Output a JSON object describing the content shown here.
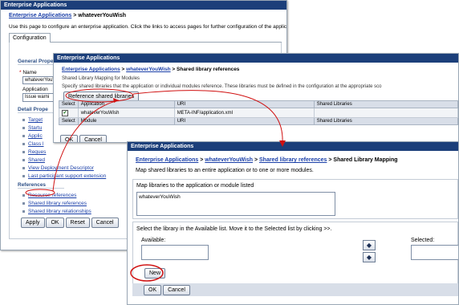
{
  "panel1": {
    "title": "Enterprise Applications",
    "breadcrumb_link": "Enterprise Applications",
    "breadcrumb_sep": " > ",
    "breadcrumb_current": "whateverYouWish",
    "description": "Use this page to configure an enterprise application. Click the links to access pages for further configuration of the applica",
    "tab": "Configuration",
    "general_heading": "General Prope",
    "name_label": "Name",
    "name_value": "whateverYouW",
    "application_label": "Application",
    "issue_value": "Issue warni",
    "detail_heading": "Detail Prope",
    "detail_links": [
      "Target",
      "Startu",
      "Applic",
      "Class l",
      "Reques",
      "Shared",
      "View Deployment Descriptor",
      "Last participant support extension"
    ],
    "references_heading": "References",
    "reference_links": [
      "Resource references",
      "Shared library references",
      "Shared library relationships"
    ],
    "buttons": {
      "apply": "Apply",
      "ok": "OK",
      "reset": "Reset",
      "cancel": "Cancel"
    }
  },
  "panel2": {
    "title": "Enterprise Applications",
    "breadcrumb": [
      "Enterprise Applications",
      "whateverYouWish",
      "Shared library references"
    ],
    "sep": " > ",
    "subtitle": "Shared Library Mapping for Modules",
    "instruction": "Specify shared libraries that the application or individual modules reference. These libraries must be defined in the configuration at the appropriate sco",
    "reference_button": "Reference shared libraries",
    "table": {
      "app_headers": [
        "Select",
        "Application",
        "URI",
        "Shared Libraries"
      ],
      "app_row": {
        "checkbox": "✔",
        "application": "whateverYouWish",
        "uri": "META-INF/application.xml",
        "libraries": ""
      },
      "module_headers": [
        "Select",
        "Module",
        "URI",
        "Shared Libraries"
      ]
    },
    "buttons": {
      "ok": "OK",
      "cancel": "Cancel"
    }
  },
  "panel3": {
    "title": "Enterprise Applications",
    "breadcrumb": [
      "Enterprise Applications",
      "whateverYouWish",
      "Shared library references"
    ],
    "breadcrumb_current": "Shared Library Mapping",
    "sep": " > ",
    "description": "Map shared libraries to an entire application or to one or more modules.",
    "map_label": "Map libraries to the application or module listed",
    "map_value": "whateverYouWish",
    "select_instruction": "Select the library in the Available list. Move it to the Selected list by clicking >>.",
    "available_label": "Available:",
    "selected_label": "Selected:",
    "new_button": "New",
    "buttons": {
      "ok": "OK",
      "cancel": "Cancel"
    }
  },
  "colors": {
    "titlebar": "#1c3f7a",
    "link": "#1a3fa8",
    "annotation": "#d01010"
  }
}
